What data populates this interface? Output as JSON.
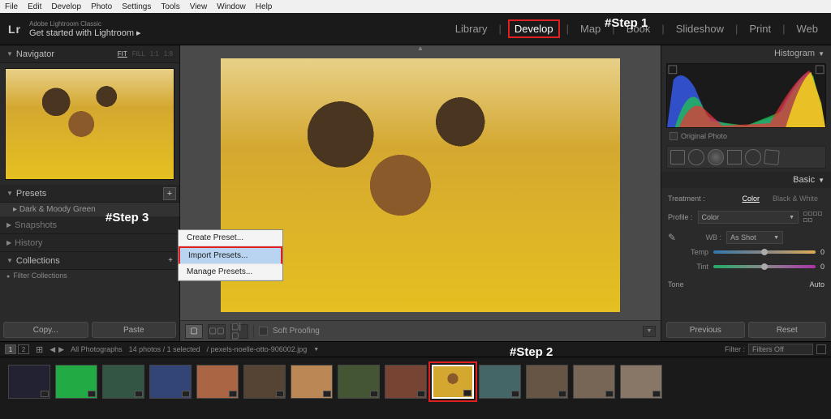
{
  "menubar": [
    "File",
    "Edit",
    "Develop",
    "Photo",
    "Settings",
    "Tools",
    "View",
    "Window",
    "Help"
  ],
  "app": {
    "brand": "Lr",
    "name": "Adobe Lightroom Classic",
    "subtitle": "Get started with Lightroom ▸"
  },
  "modules": [
    {
      "label": "Library",
      "active": false
    },
    {
      "label": "Develop",
      "active": true
    },
    {
      "label": "Map",
      "active": false
    },
    {
      "label": "Book",
      "active": false
    },
    {
      "label": "Slideshow",
      "active": false
    },
    {
      "label": "Print",
      "active": false
    },
    {
      "label": "Web",
      "active": false
    }
  ],
  "annotations": {
    "step1": "#Step 1",
    "step2": "#Step 2",
    "step3": "#Step 3"
  },
  "left": {
    "navigator": {
      "title": "Navigator",
      "opts": [
        "FIT",
        "FILL",
        "1:1",
        "1:8"
      ]
    },
    "presets": {
      "title": "Presets",
      "item": "Dark & Moody Green",
      "plus": "+"
    },
    "snapshots": "Snapshots",
    "history": "History",
    "collections": {
      "title": "Collections",
      "filter": "Filter Collections"
    },
    "copy": "Copy...",
    "paste": "Paste"
  },
  "context": {
    "create": "Create Preset...",
    "import": "Import Presets...",
    "manage": "Manage Presets..."
  },
  "center": {
    "softproof": "Soft Proofing"
  },
  "right": {
    "histogram": "Histogram",
    "original": "Original Photo",
    "basic": "Basic",
    "treatment": {
      "label": "Treatment :",
      "color": "Color",
      "bw": "Black & White"
    },
    "profile": {
      "label": "Profile :",
      "value": "Color"
    },
    "wb": {
      "label": "WB :",
      "value": "As Shot"
    },
    "temp": {
      "label": "Temp",
      "value": "0"
    },
    "tint": {
      "label": "Tint",
      "value": "0"
    },
    "tone": {
      "label": "Tone",
      "auto": "Auto"
    },
    "previous": "Previous",
    "reset": "Reset"
  },
  "filmstrip": {
    "pages": [
      "1",
      "2"
    ],
    "source": "All Photographs",
    "count": "14 photos / 1 selected",
    "filename": "/ pexels-noelle-otto-906002.jpg",
    "filter": "Filter :",
    "filtersOff": "Filters Off",
    "thumbs": 14,
    "selected": 10
  }
}
